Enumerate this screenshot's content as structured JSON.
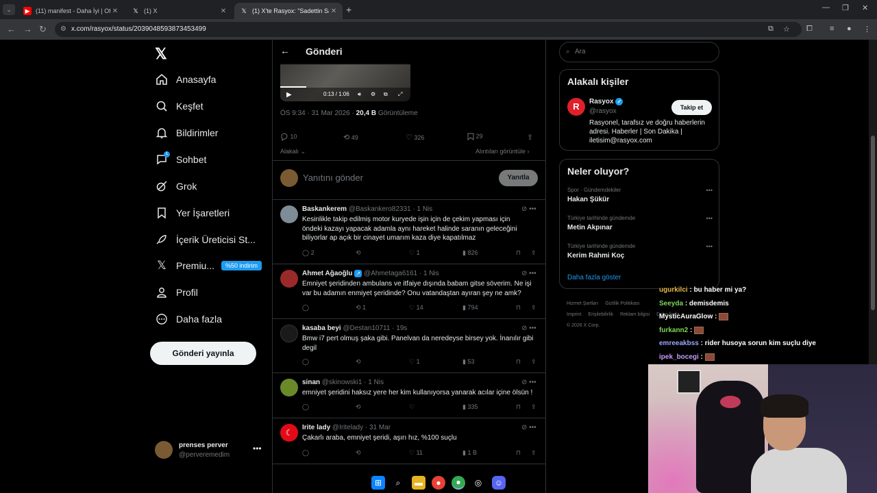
{
  "browser": {
    "tabs": [
      {
        "title": "(11) manifest - Daha İyi | Offici",
        "active": false,
        "favicon": "youtube-icon"
      },
      {
        "title": "(1) X",
        "active": false,
        "favicon": "x-icon"
      },
      {
        "title": "(1) X'te Rasyox: \"Sadettin Saran",
        "active": true,
        "favicon": "x-icon"
      }
    ],
    "url": "x.com/rasyox/status/2039048593873453499"
  },
  "sidebar": {
    "items": [
      {
        "label": "Anasayfa",
        "icon": "home-icon"
      },
      {
        "label": "Keşfet",
        "icon": "search-icon"
      },
      {
        "label": "Bildirimler",
        "icon": "bell-icon"
      },
      {
        "label": "Sohbet",
        "icon": "chat-icon",
        "badge": "1"
      },
      {
        "label": "Grok",
        "icon": "grok-icon"
      },
      {
        "label": "Yer İşaretleri",
        "icon": "bookmark-icon"
      },
      {
        "label": "İçerik Üreticisi St...",
        "icon": "rocket-icon"
      },
      {
        "label": "Premiu...",
        "icon": "x-icon",
        "tag": "%50 indirim"
      },
      {
        "label": "Profil",
        "icon": "user-icon"
      },
      {
        "label": "Daha fazla",
        "icon": "more-circle-icon"
      }
    ],
    "post_button": "Gönderi yayınla",
    "account": {
      "name": "prenses perver",
      "handle": "@perveremedim"
    }
  },
  "post": {
    "header_title": "Gönderi",
    "video_time": "0:13 / 1:06",
    "video_progress": 0.2,
    "time": "ÖS 9:34 · 31 Mar 2026 · ",
    "views": "20,4 B",
    "views_label": " Görüntüleme",
    "counts": {
      "replies": "10",
      "reposts": "49",
      "likes": "326",
      "bookmarks": "29"
    },
    "related": "Alakalı",
    "quotes_link": "Alıntıları görüntüle",
    "reply_placeholder": "Yanıtını gönder",
    "reply_button": "Yanıtla"
  },
  "replies": [
    {
      "name": "Baskankerem",
      "handle": "@Baskankero82331 · 1 Nis",
      "text": "Kesinlikle takip edilmiş motor kuryede işin için de çekim yapması için öndeki kazayı yapacak adamla aynı hareket halinde saranın geleceğini biliyorlar ap açık bir cinayet umarım kaza diye kapatılmaz",
      "replies": "2",
      "reposts": "",
      "likes": "1",
      "views": "826",
      "avatar_color": "#7d8c96"
    },
    {
      "name": "Ahmet Ağaoğlu",
      "handle": "@Ahmetaga6161 · 1 Nis",
      "text": "Emniyet şeridinden ambulans ve itfaiye dışında babam gitse söverim. Ne işi var bu adamın enmiyet şeridinde? Onu vatandaştan ayıran şey ne amk?",
      "replies": "",
      "reposts": "1",
      "likes": "14",
      "views": "794",
      "avatar_color": "#9a2a2a"
    },
    {
      "name": "kasaba beyi",
      "handle": "@Destan10711 · 19s",
      "text": "Bmw i7 pert olmuş şaka gibi. Panelvan da neredeyse birsey yok. İnanılır gibi degil",
      "replies": "",
      "reposts": "",
      "likes": "1",
      "views": "53",
      "avatar_color": "#1a1a1a"
    },
    {
      "name": "sinan",
      "handle": "@skinowski1 · 1 Nis",
      "text": "emniyet şeridini haksız yere her kim kullanıyorsa yanarak acılar içine ölsün !",
      "replies": "",
      "reposts": "",
      "likes": "",
      "views": "335",
      "avatar_color": "#6a8a2a"
    },
    {
      "name": "Irite lady",
      "handle": "@Iritelady · 31 Mar",
      "text": "Çakarlı araba, emniyet şeridi, aşırı hız, %100 suçlu",
      "replies": "",
      "reposts": "",
      "likes": "11",
      "views": "1 B",
      "avatar_color": "#e30a17"
    }
  ],
  "right": {
    "search_placeholder": "Ara",
    "relevant_title": "Alakalı kişiler",
    "relevant": {
      "name": "Rasyox",
      "handle": "@rasyox",
      "follow": "Takip et",
      "bio": "Rasyonel, tarafsız ve doğru haberlerin adresi. Haberler | Son Dakika | iletisim@rasyox.com"
    },
    "trends_title": "Neler oluyor?",
    "trends": [
      {
        "context": "Spor · Gündemdekiler",
        "name": "Hakan Şükür"
      },
      {
        "context": "Türkiye tarihinde gündemde",
        "name": "Metin Akpınar"
      },
      {
        "context": "Türkiye tarihinde gündemde",
        "name": "Kerim Rahmi Koç"
      }
    ],
    "show_more": "Daha fazla göster",
    "footer": [
      "Hizmet Şartları",
      "Gizlilik Politikası",
      "Imprint",
      "Erişilebilirlik",
      "Reklam bilgisi",
      "Daha fazla",
      "© 2026 X Corp."
    ]
  },
  "chat": [
    {
      "user": "ugurkilci",
      "color": "#e8b84a",
      "msg": ": bu haber mi ya?"
    },
    {
      "user": "Seeyda",
      "color": "#7ed957",
      "msg": ": demisdemis"
    },
    {
      "user": "MysticAuraGlow",
      "color": "#ffffff",
      "msg": ":",
      "emote": true
    },
    {
      "user": "furkann2",
      "color": "#7ed957",
      "msg": ":",
      "emote": true
    },
    {
      "user": "emreeakbss",
      "color": "#9aa8ff",
      "msg": ": rider husoya sorun kim suçlu diye"
    },
    {
      "user": "ipek_bocegi",
      "color": "#c79bff",
      "msg": ":",
      "emote": true
    }
  ],
  "colors": {
    "accent": "#1d9bf0",
    "bg": "#000000",
    "border": "#2f3336",
    "muted": "#71767b"
  }
}
